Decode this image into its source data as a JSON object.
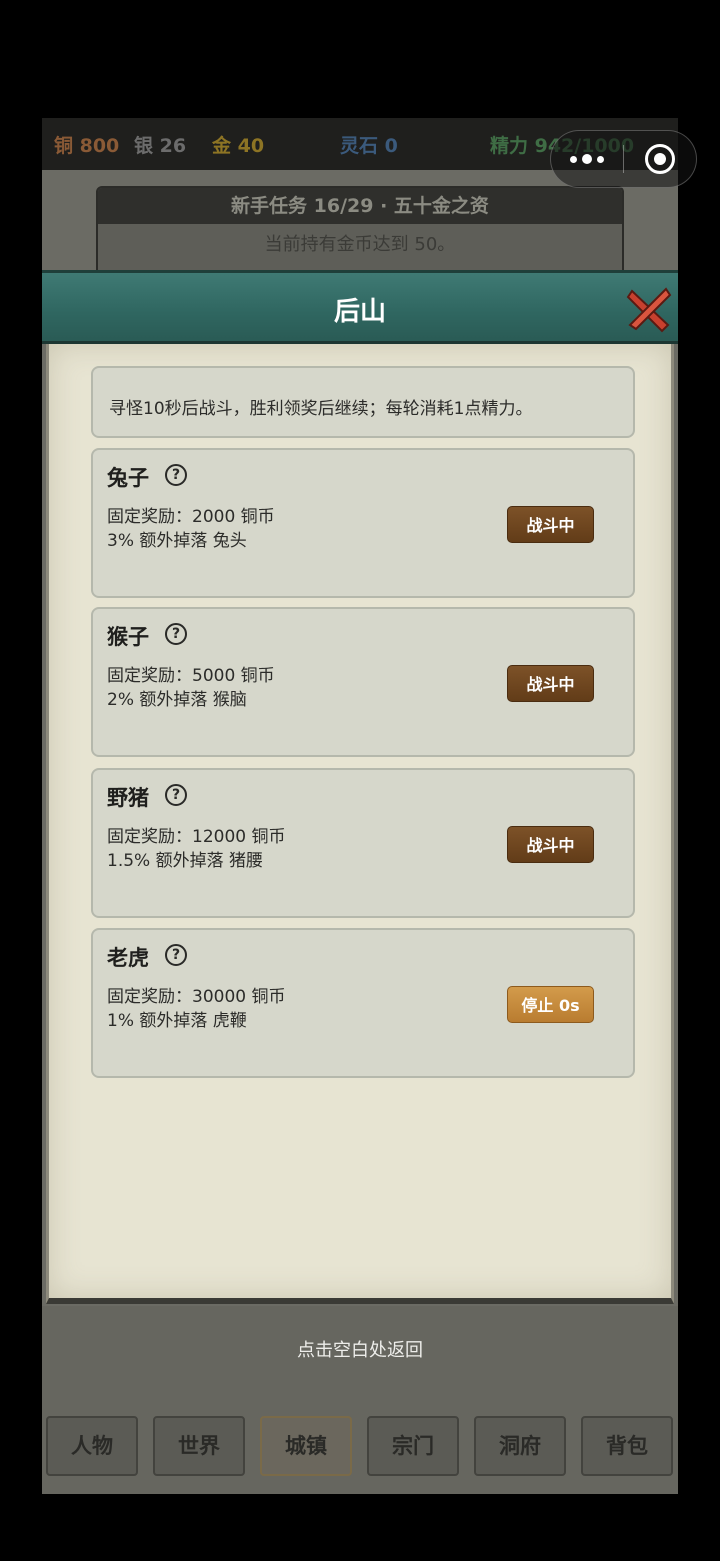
{
  "resources": {
    "copper": "铜 800",
    "silver": "银 26",
    "gold": "金 40",
    "spirit_stone": "灵石 0",
    "energy": "精力 942/1000"
  },
  "task": {
    "title": "新手任务 16/29 · 五十金之资",
    "description": "当前持有金币达到 50。"
  },
  "modal": {
    "title": "后山",
    "description": "寻怪10秒后战斗，胜利领奖后继续；每轮消耗1点精力。"
  },
  "monsters": [
    {
      "name": "兔子",
      "reward": "固定奖励：2000 铜币",
      "drop": "3% 额外掉落 兔头",
      "button": "战斗中",
      "state": "fighting"
    },
    {
      "name": "猴子",
      "reward": "固定奖励：5000 铜币",
      "drop": "2% 额外掉落 猴脑",
      "button": "战斗中",
      "state": "fighting"
    },
    {
      "name": "野猪",
      "reward": "固定奖励：12000 铜币",
      "drop": "1.5% 额外掉落 猪腰",
      "button": "战斗中",
      "state": "fighting"
    },
    {
      "name": "老虎",
      "reward": "固定奖励：30000 铜币",
      "drop": "1% 额外掉落 虎鞭",
      "button": "停止 0s",
      "state": "stopped"
    }
  ],
  "help_symbol": "?",
  "back_hint": "点击空白处返回",
  "nav": [
    {
      "label": "人物"
    },
    {
      "label": "世界"
    },
    {
      "label": "城镇",
      "active": true
    },
    {
      "label": "宗门"
    },
    {
      "label": "洞府"
    },
    {
      "label": "背包"
    }
  ],
  "colors": {
    "fight_button": "#6f4620",
    "stop_button": "#c88a3c",
    "header_teal": "#2f6660",
    "parchment": "#e7e4d2"
  }
}
